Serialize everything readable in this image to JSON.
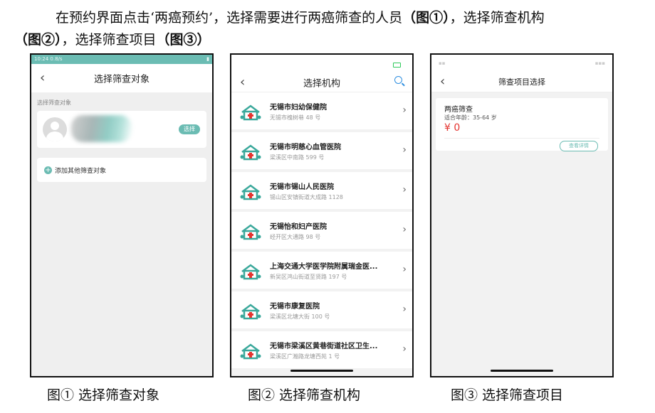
{
  "paragraph": {
    "a": "在预约界面点击‘两癌预约’，选择需要进行两癌筛查的人员",
    "b": "（图①）",
    "c": "，选择筛查机构",
    "d": "（图②）",
    "e": "，选择筛查项目",
    "f": "（图③）"
  },
  "captions": {
    "fig1": "图①  选择筛查对象",
    "fig2": "图②  选择筛查机构",
    "fig3": "图③  选择筛查项目"
  },
  "screen1": {
    "status_time": "10:24",
    "status_net": "0.8/s",
    "title": "选择筛查对象",
    "back_icon": "‹",
    "section_label": "选择筛查对象",
    "select_button": "选择",
    "add_label": "添加其他筛查对象",
    "accent": "#6bbcb3"
  },
  "screen2": {
    "title": "选择机构",
    "institutions": [
      {
        "name": "无锡市妇幼保健院",
        "address": "无锡市槐树巷 48 号"
      },
      {
        "name": "无锡市明慈心血管医院",
        "address": "梁溪区中南路 599 号"
      },
      {
        "name": "无锡市锡山人民医院",
        "address": "锡山区安镇街道大成路 1128"
      },
      {
        "name": "无锡怡和妇产医院",
        "address": "经开区大通路 98 号"
      },
      {
        "name": "上海交通大学医学院附属瑞金医...",
        "address": "新吴区鸿山街道至贤路 197 号"
      },
      {
        "name": "无锡市康复医院",
        "address": "梁溪区北塘大街 100 号"
      },
      {
        "name": "无锡市梁溪区黄巷街道社区卫生...",
        "address": "梁溪区广瀚路龙塘西苑 1 号"
      }
    ]
  },
  "screen3": {
    "title": "筛查项目选择",
    "item_name": "两癌筛查",
    "item_age": "适合年龄：35-64 岁",
    "item_price": "¥ 0",
    "detail_button": "查看详情"
  }
}
